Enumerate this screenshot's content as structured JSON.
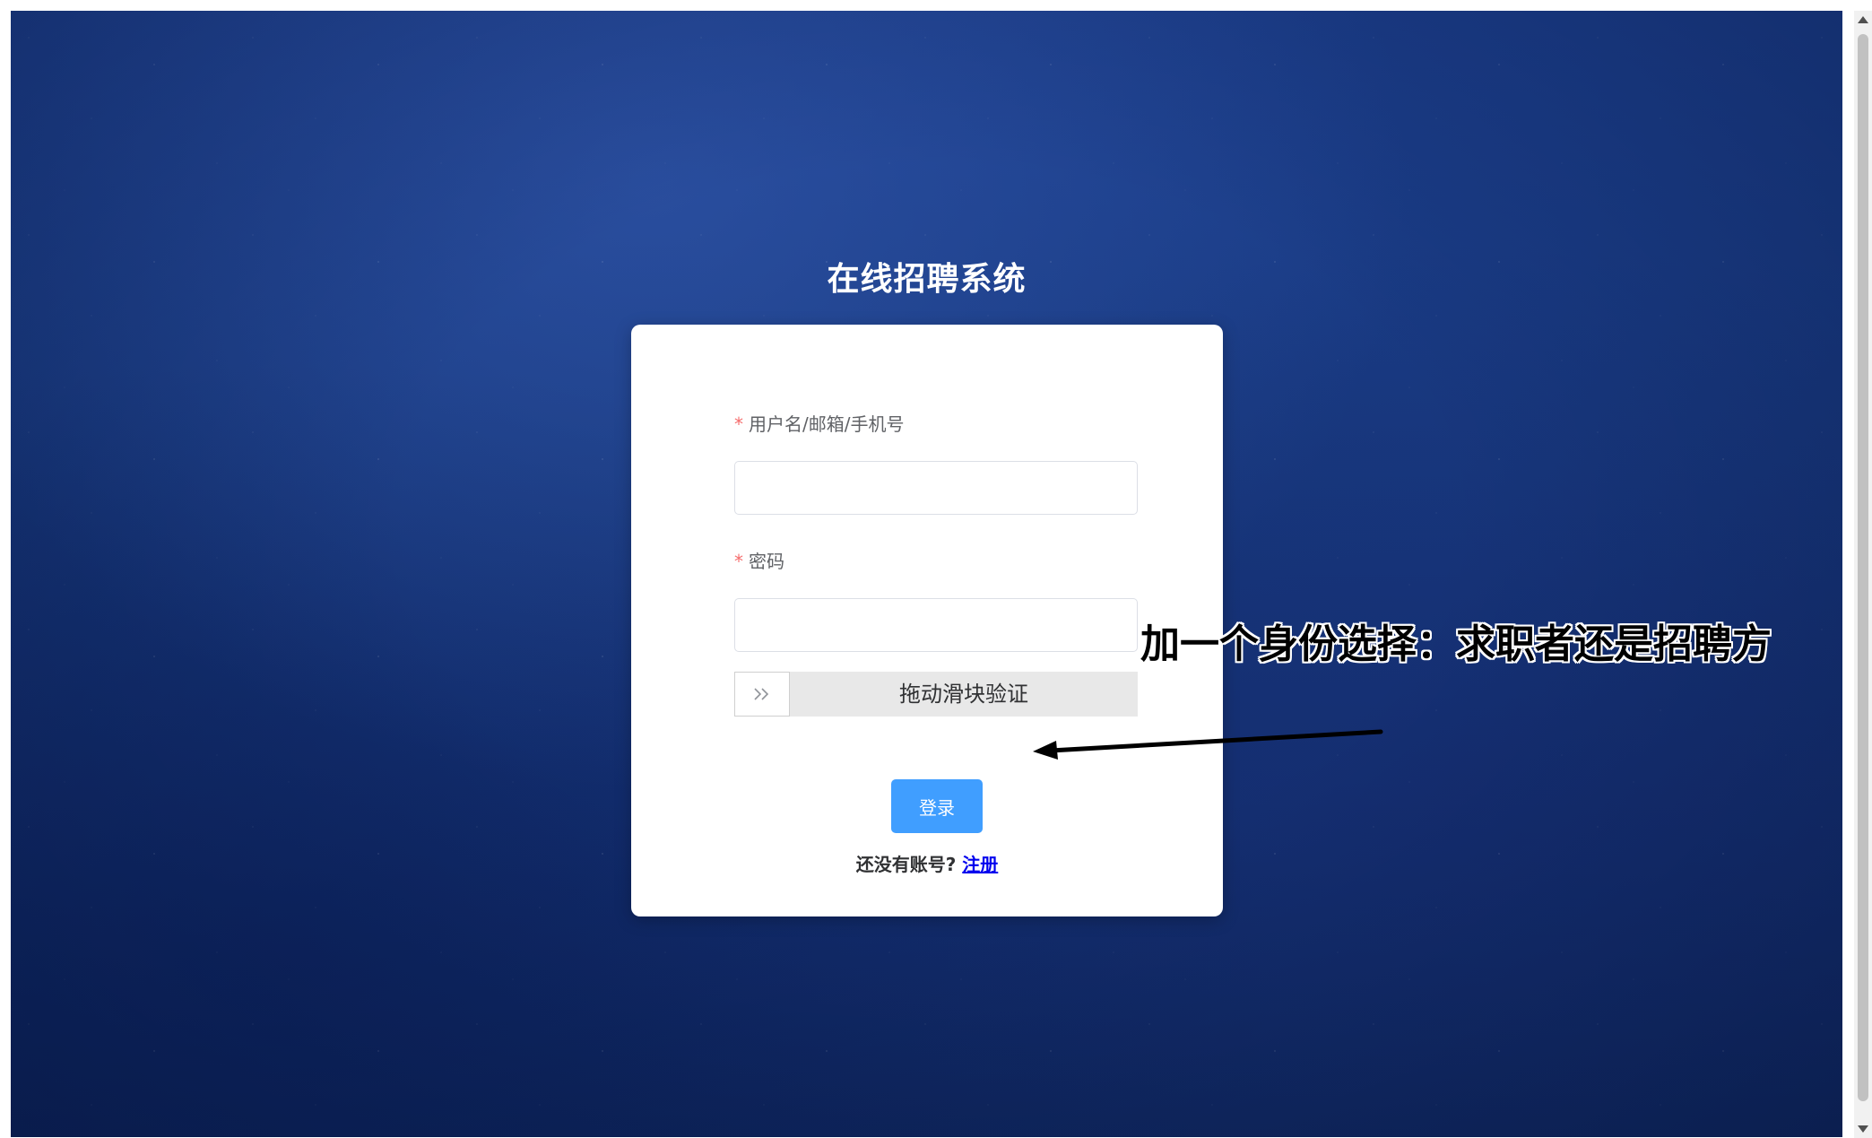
{
  "app": {
    "title": "在线招聘系统"
  },
  "login_form": {
    "username_label": "用户名/邮箱/手机号",
    "username_value": "",
    "password_label": "密码",
    "password_value": "",
    "required_mark": "*",
    "slider_text": "拖动滑块验证",
    "slider_handle_icon": "double-chevron-right-icon",
    "login_button": "登录",
    "register_prompt": "还没有账号?",
    "register_link": "注册"
  },
  "annotation": {
    "text": "加一个身份选择：求职者还是招聘方"
  },
  "colors": {
    "primary_button": "#409eff",
    "required_star": "#f56c6c",
    "link": "#0000ee",
    "background": "#1c3f8e"
  }
}
